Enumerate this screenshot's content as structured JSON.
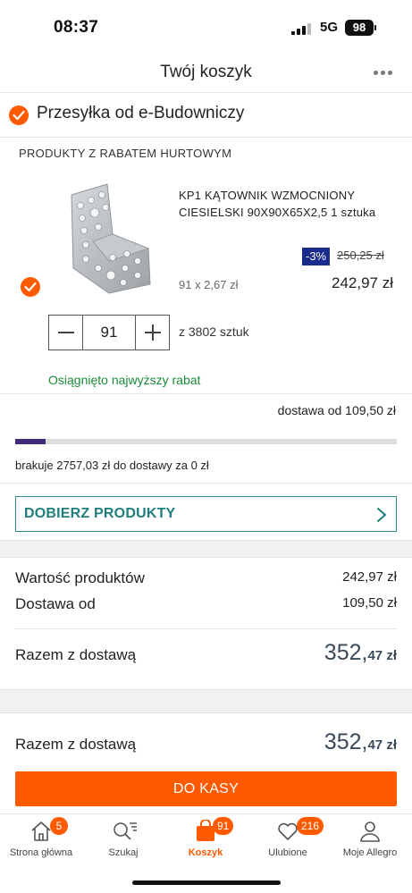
{
  "status_bar": {
    "time": "08:37",
    "network": "5G",
    "battery": "98"
  },
  "header": {
    "title": "Twój koszyk"
  },
  "seller": {
    "name": "Przesyłka od e-Budowniczy"
  },
  "section": {
    "label": "PRODUKTY Z RABATEM HURTOWYM"
  },
  "product": {
    "name": "KP1 KĄTOWNIK WZMOCNIONY CIESIELSKI 90X90X65X2,5 1 sztuka",
    "discount": "-3%",
    "old_price": "250,25 zł",
    "unit_price": "91 x 2,67 zł",
    "line_price": "242,97 zł",
    "quantity": "91",
    "stock": "z 3802 sztuk",
    "discount_note": "Osiągnięto najwyższy rabat"
  },
  "delivery": {
    "from_label": "dostawa od 109,50 zł",
    "progress": 0.08,
    "missing_text": "brakuje 2757,03 zł do dostawy za 0 zł"
  },
  "add_products": {
    "label": "DOBIERZ PRODUKTY"
  },
  "summary": {
    "products_label": "Wartość produktów",
    "products_value": "242,97 zł",
    "delivery_label": "Dostawa od",
    "delivery_value": "109,50 zł",
    "total_label": "Razem z dostawą",
    "total_main": "352,",
    "total_cents": "47 zł"
  },
  "footer_total": {
    "label": "Razem z dostawą",
    "main": "352,",
    "cents": "47 zł"
  },
  "checkout": {
    "label": "DO KASY"
  },
  "tabs": [
    {
      "label": "Strona główna",
      "icon": "home-icon",
      "badge": "5"
    },
    {
      "label": "Szukaj",
      "icon": "search-icon",
      "badge": ""
    },
    {
      "label": "Koszyk",
      "icon": "cart-icon",
      "badge": "91"
    },
    {
      "label": "Ulubione",
      "icon": "heart-icon",
      "badge": "216"
    },
    {
      "label": "Moje Allegro",
      "icon": "user-icon",
      "badge": ""
    }
  ],
  "colors": {
    "accent": "#ff5a00",
    "teal": "#1f7f7c",
    "success": "#1a8a3a",
    "badge_blue": "#1a2b8c",
    "progress": "#3f2a7a"
  }
}
